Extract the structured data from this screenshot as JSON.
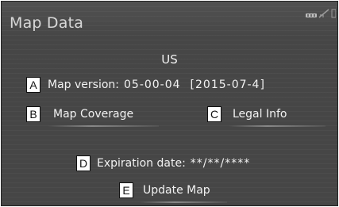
{
  "header": {
    "title": "Map Data"
  },
  "status": {
    "icons": [
      "signal-icon",
      "no-connection-icon"
    ]
  },
  "region": "US",
  "callouts": {
    "a": "A",
    "b": "B",
    "c": "C",
    "d": "D",
    "e": "E"
  },
  "map_version": {
    "label": "Map version:",
    "value": "05-00-04",
    "date": "[2015-07-4]"
  },
  "buttons": {
    "map_coverage": "Map Coverage",
    "legal_info": "Legal Info",
    "update_map": "Update Map"
  },
  "expiration": {
    "label": "Expiration date:",
    "value": "**/**/****"
  }
}
